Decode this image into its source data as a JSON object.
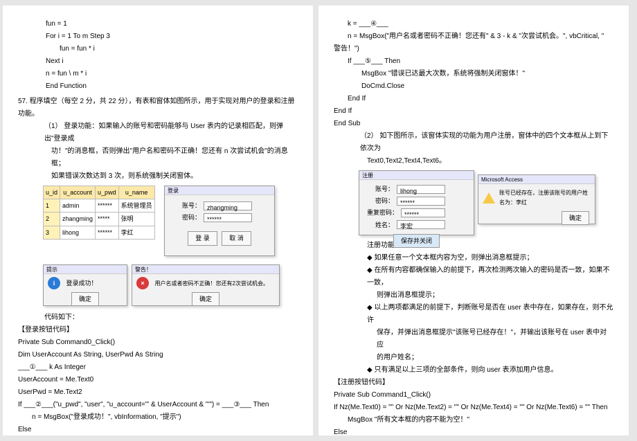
{
  "left": {
    "c01": "fun = 1",
    "c02": "For i = 1 To m Step 3",
    "c03": "fun = fun * i",
    "c04": "Next i",
    "c05": "n = fun \\ m * i",
    "c06": "End Function",
    "q57": "57. 程序填空（每空 2 分，共 22 分），有表和窗体如图所示，用于实现对用户的登录和注册功能。",
    "p1a": "（1） 登录功能：如果输入的账号和密码能够与 User 表内的记录相匹配，则弹出\"登录成",
    "p1b": "功！\"的消息框，否则弹出\"用户名和密码不正确！您还有 n 次尝试机会\"的消息框；",
    "p1c": "如果错误次数达到 3 次，则系统强制关闭窗体。",
    "tbl": {
      "h1": "u_id",
      "h2": "u_account",
      "h3": "u_pwd",
      "h4": "u_name",
      "r1c1": "1",
      "r1c2": "admin",
      "r1c3": "******",
      "r1c4": "系统管理员",
      "r2c1": "2",
      "r2c2": "zhangming",
      "r2c3": "*****",
      "r2c4": "张明",
      "r3c1": "3",
      "r3c2": "lihong",
      "r3c3": "******",
      "r3c4": "李红"
    },
    "login": {
      "title": "登录",
      "lbl_acc": "账号：",
      "val_acc": "zhangming",
      "lbl_pwd": "密码：",
      "val_pwd": "******",
      "btn_login": "登 录",
      "btn_cancel": "取 消"
    },
    "msg1": {
      "title": "提示",
      "txt": "登录成功！",
      "btn": "确定"
    },
    "msg2": {
      "title": "警告！",
      "txt": "用户名或者密码不正确！您还有2次尝试机会。",
      "btn": "确定"
    },
    "code_label": "代码如下：",
    "sec1": "【登录按钮代码】",
    "l01": "Private Sub Command0_Click()",
    "l02": "Dim UserAccount As String, UserPwd As String",
    "l03": "___①___ k As Integer",
    "l04": "UserAccount = Me.Text0",
    "l05": "UserPwd = Me.Text2",
    "l06": "If ___②___(\"u_pwd\", \"user\", \"u_account='\" & UserAccount & \"'\") = ___③___ Then",
    "l07": "n = MsgBox(\"登录成功！\", vbInformation, \"提示\")",
    "l08": "Else"
  },
  "right": {
    "r01": "k = ___④___",
    "r02": "n = MsgBox(\"用户名或者密码不正确！您还有\" & 3 - k & \"次尝试机会。\", vbCritical, \"",
    "r02b": "警告！\")",
    "r03": "If ___⑤___ Then",
    "r04": "MsgBox \"错误已达最大次数，系统将强制关闭窗体！\"",
    "r05": "DoCmd.Close",
    "r06": "End If",
    "r07": "End If",
    "r08": "End Sub",
    "p2a": "（2） 如下图所示，该窗体实现的功能为用户注册，窗体中的四个文本框从上到下依次为",
    "p2b": "Text0,Text2,Text4,Text6。",
    "reg": {
      "title": "注册",
      "lbl_acc": "账号：",
      "val_acc": "lihong",
      "lbl_pwd": "密码：",
      "val_pwd": "******",
      "lbl_pwd2": "重复密码：",
      "val_pwd2": "******",
      "lbl_name": "姓名：",
      "val_name": "李宏",
      "btn": "保存并关闭"
    },
    "msg3": {
      "title": "Microsoft Access",
      "txt": "账号已经存在，注册该账号的用户姓名为：李红",
      "btn": "确定"
    },
    "desc": "注册功能描述如下：",
    "b1": "如果任意一个文本框内容为空，则弹出消息框提示；",
    "b2a": "在所有内容都确保输入的前提下，再次检测两次输入的密码是否一致，如果不一致，",
    "b2b": "则弹出消息框提示；",
    "b3a": "以上两项都满足的前提下，判断账号是否在 user 表中存在，如果存在，则不允许",
    "b3b": "保存，并弹出消息框提示\"该账号已经存在！\"，并输出该账号在 user 表中对应",
    "b3c": "的用户姓名；",
    "b4": "只有满足以上三项的全部条件，则向 user 表添加用户信息。",
    "sec2": "【注册按钮代码】",
    "s01": "Private Sub Command1_Click()",
    "s02": "If Nz(Me.Text0) = \"\" Or Nz(Me.Text2) = \"\" Or Nz(Me.Text4) = \"\" Or Nz(Me.Text6) = \"\" Then",
    "s03": "MsgBox \"所有文本框的内容不能为空！\"",
    "s04": "Else"
  }
}
